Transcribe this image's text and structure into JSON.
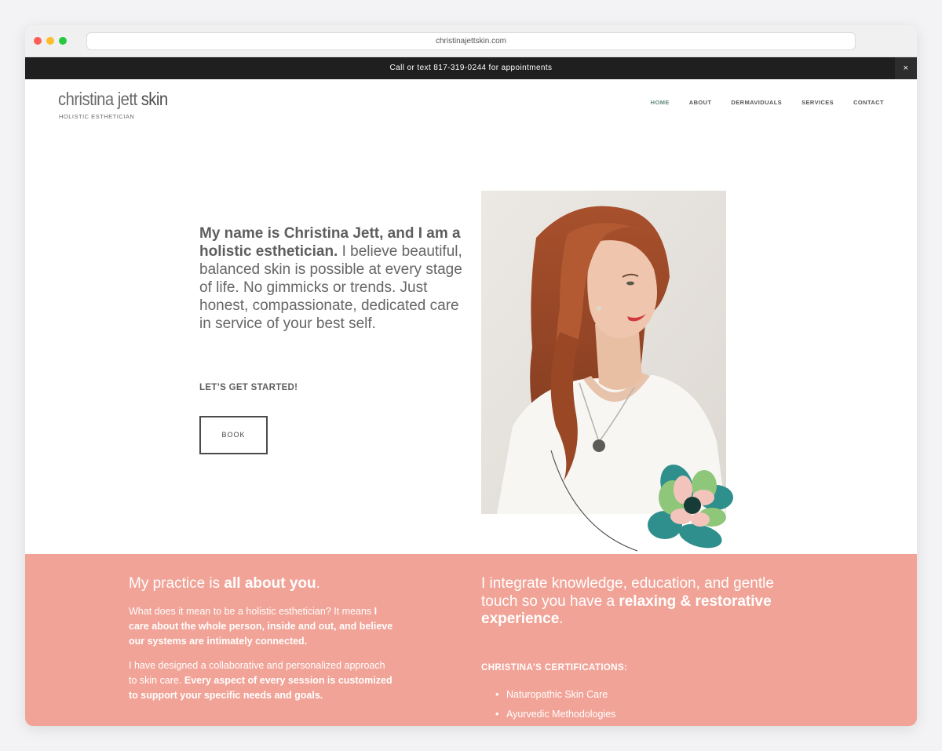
{
  "browser": {
    "url": "christinajettskin.com"
  },
  "announcement": {
    "text": "Call or text 817-319-0244 for appointments",
    "close_label": "×"
  },
  "logo": {
    "name_light": "christina jett ",
    "name_bold": "skin",
    "tagline": "HOLISTIC ESTHETICIAN"
  },
  "nav": {
    "items": [
      {
        "label": "HOME",
        "active": true
      },
      {
        "label": "ABOUT"
      },
      {
        "label": "DERMAVIDUALS"
      },
      {
        "label": "SERVICES"
      },
      {
        "label": "CONTACT"
      }
    ]
  },
  "hero": {
    "intro_bold": "My name is Christina Jett, and I am a holistic esthetician.",
    "intro_rest": " I believe beautiful, balanced skin is possible at every stage of life. No gimmicks or trends. Just honest, compassionate, dedicated care in service of your best self.",
    "cta_heading": "LET’S GET STARTED!",
    "book_label": "BOOK"
  },
  "practice": {
    "heading_pre": "My practice is ",
    "heading_bold": "all about you",
    "heading_post": ".",
    "para1_plain": "What does it mean to be a holistic esthetician? It means ",
    "para1_bold": "I care about the whole person, inside and out, and believe our systems are intimately connected.",
    "para2_plain": "I have designed a collaborative and personalized approach to skin care. ",
    "para2_bold": "Every aspect of every session is customized to support your specific needs and goals."
  },
  "integrate": {
    "heading_pre": "I integrate knowledge, education, and gentle touch so you have a ",
    "heading_bold": "relaxing & restorative experience",
    "heading_post": "."
  },
  "certifications": {
    "title": "CHRISTINA’S CERTIFICATIONS:",
    "items": [
      "Naturopathic Skin Care",
      "Ayurvedic Methodologies"
    ]
  },
  "colors": {
    "accent_pink": "#f1a397",
    "nav_active": "#5f8a7c",
    "announce_bg": "#1f1f1f"
  }
}
